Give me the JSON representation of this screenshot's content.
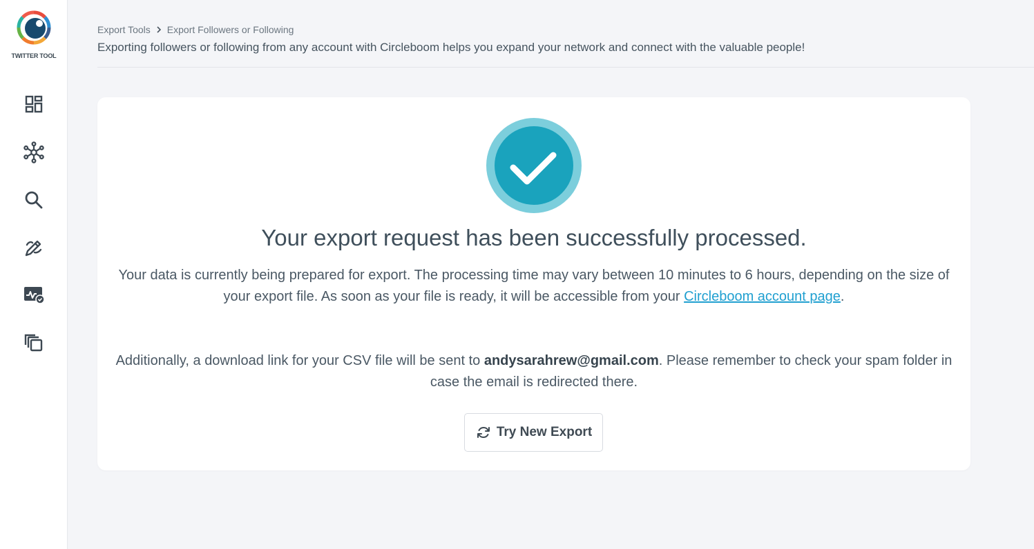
{
  "app": {
    "logo_text": "TWITTER TOOL"
  },
  "sidebar": {
    "items": [
      {
        "icon": "dashboard-icon"
      },
      {
        "icon": "network-icon"
      },
      {
        "icon": "search-icon"
      },
      {
        "icon": "design-pencil-icon"
      },
      {
        "icon": "analytics-icon"
      },
      {
        "icon": "copy-icon"
      }
    ]
  },
  "breadcrumb": {
    "items": [
      "Export Tools",
      "Export Followers or Following"
    ]
  },
  "header": {
    "subtitle": "Exporting followers or following from any account with Circleboom helps you expand your network and connect with the valuable people!"
  },
  "result": {
    "title": "Your export request has been successfully processed.",
    "para1_text": "Your data is currently being prepared for export. The processing time may vary between 10 minutes to 6 hours, depending on the size of your export file. As soon as your file is ready, it will be accessible from your ",
    "para1_link": "Circleboom account page",
    "para1_end": ".",
    "para2_start": "Additionally, a download link for your CSV file will be sent to ",
    "email": "andysarahrew@gmail.com",
    "para2_end": ". Please remember to check your spam folder in case the email is redirected there.",
    "button_label": "Try New Export"
  },
  "colors": {
    "accent": "#1aa3bd",
    "accent_ring": "#7ccedc",
    "link": "#1f9fd0"
  }
}
